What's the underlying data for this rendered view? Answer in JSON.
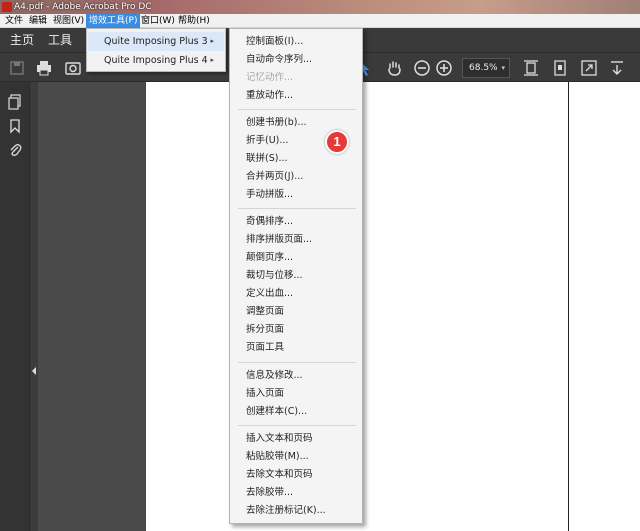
{
  "window": {
    "title": "A4.pdf - Adobe Acrobat Pro DC"
  },
  "menubar": {
    "items": [
      "文件",
      "编辑",
      "视图(V)",
      "增效工具(P)",
      "窗口(W)",
      "帮助(H)"
    ]
  },
  "nav": {
    "home": "主页",
    "tools": "工具"
  },
  "toolbar": {
    "zoom": "68.5%"
  },
  "submenu1": {
    "items": [
      {
        "label": "Quite Imposing Plus 3",
        "arrow": "▸"
      },
      {
        "label": "Quite Imposing Plus 4",
        "arrow": "▸"
      }
    ]
  },
  "submenu2": {
    "items": [
      "控制面板(I)...",
      "自动命令序列...",
      "记忆动作...",
      "重放动作...",
      "创建书册(b)...",
      "折手(U)...",
      "联拼(S)...",
      "合并两页(J)...",
      "手动拼版...",
      "奇偶排序...",
      "排序拼版页面...",
      "颠倒页序...",
      "裁切与位移...",
      "定义出血...",
      "调整页面",
      "拆分页面",
      "页面工具",
      "信息及修改...",
      "插入页面",
      "创建样本(C)...",
      "插入文本和页码",
      "粘贴胶带(M)...",
      "去除文本和页码",
      "去除胶带...",
      "去除注册标记(K)..."
    ]
  },
  "annotation": {
    "badge": "1"
  },
  "colors": {
    "menu_active": "#3a8ce0",
    "hover": "#dbe8f7",
    "badge": "#e63a3a",
    "dark_ui": "#3a3a3a"
  }
}
